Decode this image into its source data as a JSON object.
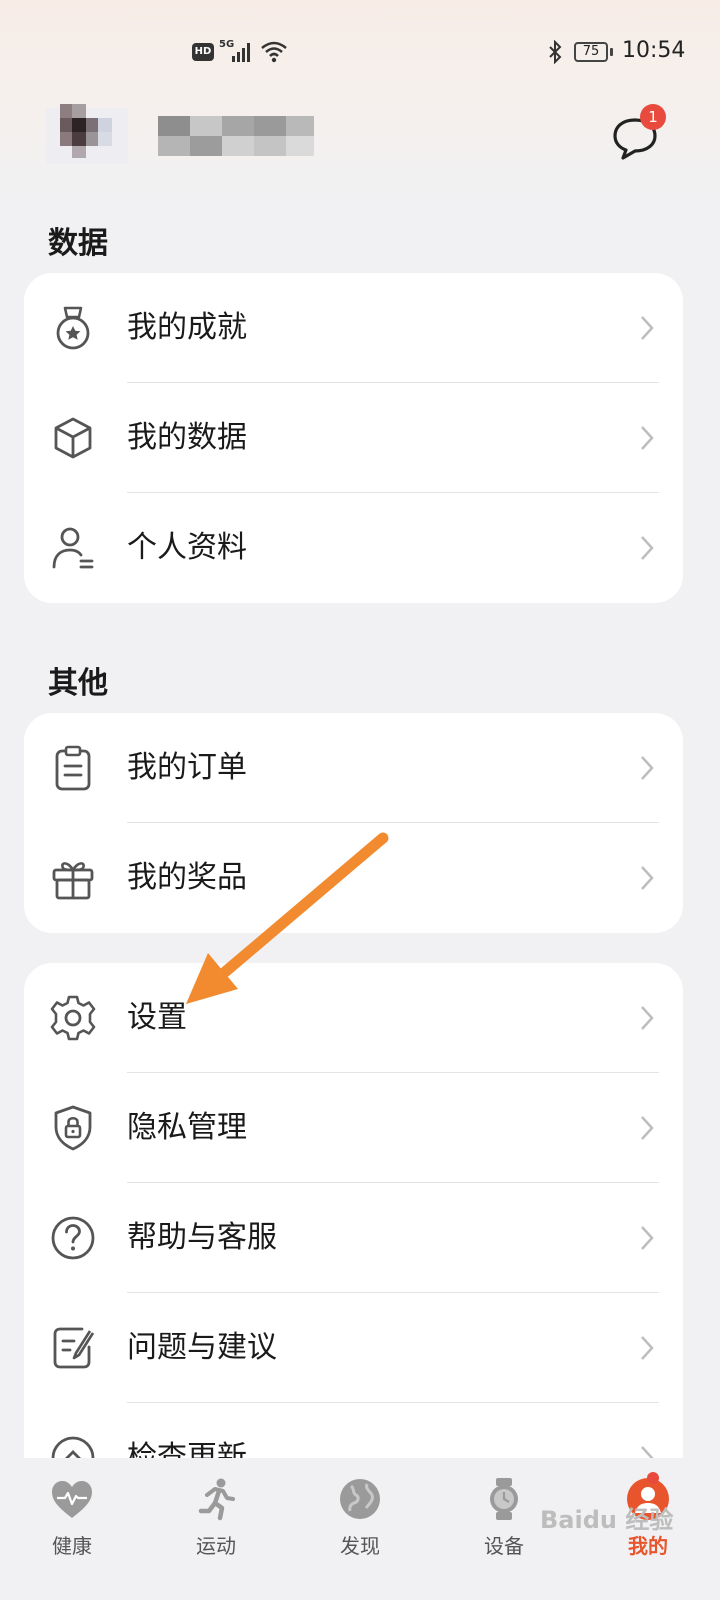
{
  "status_bar": {
    "hd": "HD",
    "network": "5G",
    "battery": "75",
    "time": "10:54"
  },
  "profile": {
    "message_badge": "1"
  },
  "sections": {
    "data_title": "数据",
    "other_title": "其他"
  },
  "data_card": [
    {
      "label": "我的成就",
      "icon": "medal-icon"
    },
    {
      "label": "我的数据",
      "icon": "cube-icon"
    },
    {
      "label": "个人资料",
      "icon": "person-icon"
    }
  ],
  "other_card": [
    {
      "label": "我的订单",
      "icon": "clipboard-icon"
    },
    {
      "label": "我的奖品",
      "icon": "gift-icon"
    }
  ],
  "settings_card": [
    {
      "label": "设置",
      "icon": "gear-icon"
    },
    {
      "label": "隐私管理",
      "icon": "shield-lock-icon"
    },
    {
      "label": "帮助与客服",
      "icon": "help-icon"
    },
    {
      "label": "问题与建议",
      "icon": "feedback-icon"
    },
    {
      "label": "检查更新",
      "icon": "update-icon"
    }
  ],
  "bottom_nav": [
    {
      "label": "健康",
      "icon": "heart-icon"
    },
    {
      "label": "运动",
      "icon": "runner-icon"
    },
    {
      "label": "发现",
      "icon": "globe-icon"
    },
    {
      "label": "设备",
      "icon": "watch-icon"
    },
    {
      "label": "我的",
      "icon": "avatar-icon",
      "active": true
    }
  ],
  "colors": {
    "accent": "#e8552d",
    "arrow": "#f28b30",
    "badge": "#e84a3e",
    "background": "#f1f1f3"
  },
  "watermark": "Baidu 经验"
}
